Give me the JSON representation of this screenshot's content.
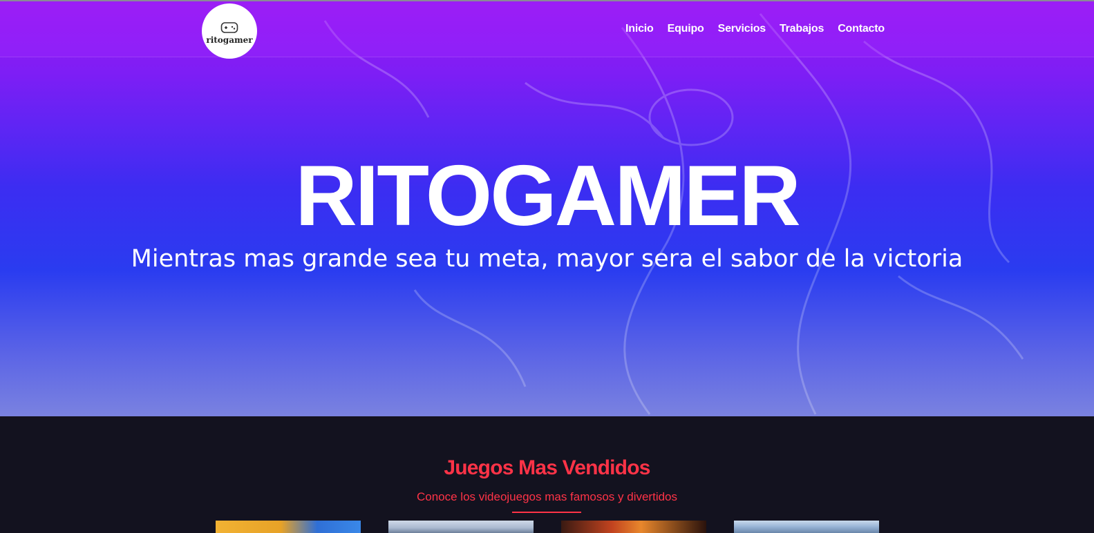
{
  "header": {
    "logo_text": "ritogamer",
    "nav": [
      "Inicio",
      "Equipo",
      "Servicios",
      "Trabajos",
      "Contacto"
    ]
  },
  "hero": {
    "title": "RITOGAMER",
    "subtitle": "Mientras mas grande sea tu meta, mayor sera el sabor de la victoria"
  },
  "section": {
    "title": "Juegos Mas Vendidos",
    "subtitle": "Conoce los videojuegos mas famosos y divertidos"
  },
  "colors": {
    "accent": "#ff3347",
    "dark_bg": "#13121f",
    "hero_top": "#9a18f2",
    "hero_mid": "#3c2df2"
  },
  "icons": {
    "logo": "gamepad-icon"
  }
}
